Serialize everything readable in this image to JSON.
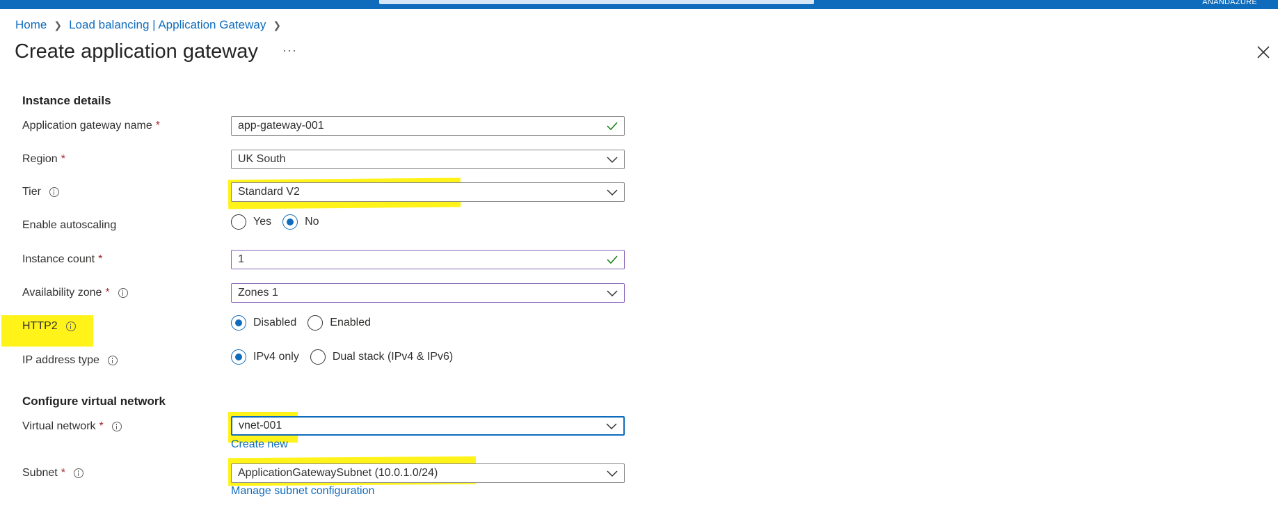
{
  "topbar": {
    "user": "ANANDAZURE"
  },
  "breadcrumb": {
    "items": [
      "Home",
      "Load balancing | Application Gateway"
    ]
  },
  "page": {
    "title": "Create application gateway",
    "more": "···"
  },
  "sections": {
    "instance": "Instance details",
    "vnet": "Configure virtual network"
  },
  "fields": {
    "gateway_name": {
      "label": "Application gateway name",
      "value": "app-gateway-001"
    },
    "region": {
      "label": "Region",
      "value": "UK South"
    },
    "tier": {
      "label": "Tier",
      "value": "Standard V2"
    },
    "autoscaling": {
      "label": "Enable autoscaling",
      "options": [
        "Yes",
        "No"
      ],
      "selected": "No"
    },
    "instance_count": {
      "label": "Instance count",
      "value": "1"
    },
    "availability_zone": {
      "label": "Availability zone",
      "value": "Zones 1"
    },
    "http2": {
      "label": "HTTP2",
      "options": [
        "Disabled",
        "Enabled"
      ],
      "selected": "Disabled"
    },
    "ip_type": {
      "label": "IP address type",
      "options": [
        "IPv4 only",
        "Dual stack (IPv4 & IPv6)"
      ],
      "selected": "IPv4 only"
    },
    "vnet": {
      "label": "Virtual network",
      "value": "vnet-001",
      "link": "Create new"
    },
    "subnet": {
      "label": "Subnet",
      "value": "ApplicationGatewaySubnet (10.0.1.0/24)",
      "link": "Manage subnet configuration"
    }
  },
  "colors": {
    "accent": "#0f6cbd",
    "required": "#a4262c",
    "valid": "#107c10",
    "highlight": "#fff200"
  }
}
